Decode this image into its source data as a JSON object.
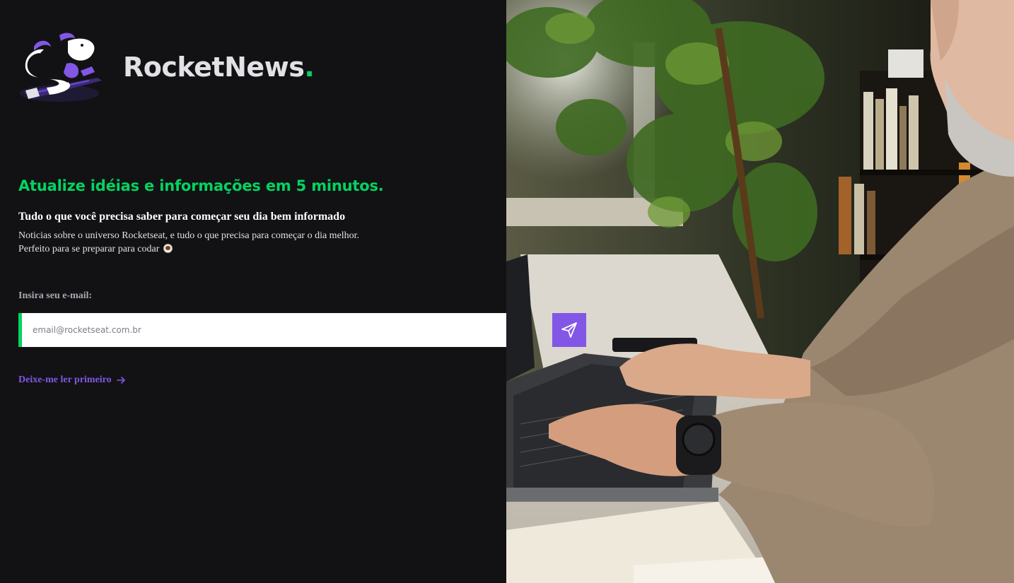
{
  "brand": {
    "name": "RocketNews",
    "dot": "."
  },
  "hero": {
    "headline": "Atualize idéias e informações em 5 minutos.",
    "subtitle": "Tudo o que você precisa saber para começar seu dia bem informado",
    "body_line1": "Noticias sobre o universo Rocketseat, e tudo o que precisa para começar o dia melhor.",
    "body_line2": "Perfeito para se preparar para codar"
  },
  "signup": {
    "label": "Insira seu e-mail:",
    "placeholder": "email@rocketseat.com.br",
    "value": "",
    "submit_icon": "send-icon"
  },
  "read_first": {
    "label": "Deixe-me ler primeiro",
    "icon": "arrow-right-icon"
  },
  "photo": {
    "subject_icon": "man-typing-on-laptop-photo"
  },
  "colors": {
    "background": "#121214",
    "accent_green": "#04d361",
    "accent_purple": "#8257e5",
    "text_light": "#e1e1e6",
    "text_muted": "#a8a8b3",
    "input_bg": "#ffffff"
  }
}
